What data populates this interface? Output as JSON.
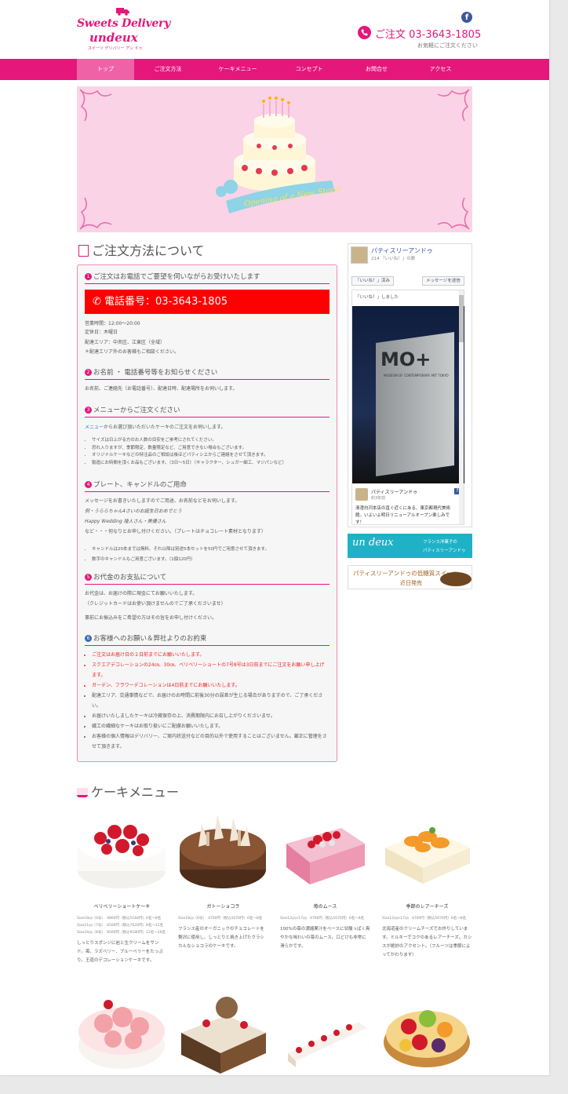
{
  "header": {
    "logo_line1": "Sweets Delivery",
    "logo_line2": "undeux",
    "logo_sub": "スイーツ デリバリー アン ドゥ",
    "order_tel": "ご注文 03-3643-1805",
    "order_note": "お気軽にご注文ください",
    "facebook_letter": "f"
  },
  "nav": [
    "トップ",
    "ご注文方法",
    "ケーキメニュー",
    "コンセプト",
    "お問合せ",
    "アクセス"
  ],
  "hero": {
    "banner_text": "Opening of a New Store!"
  },
  "order_section": {
    "title": "ご注文方法について",
    "step1": {
      "title": "ご注文はお電話でご要望を伺いながらお受けいたします",
      "tel": "電話番号：03-3643-1805",
      "lines": [
        "営業時間：12:00〜20:00",
        "定休日：木曜日",
        "配達エリア：中央区、江東区（全域）",
        "＊配達エリア外のお客様もご相談ください。"
      ]
    },
    "step2": {
      "title": "お名前 ・ 電話番号等をお知らせください",
      "text": "お名前、ご連絡先（お電話番号）、配達日時、配達場所をお伺いします。"
    },
    "step3": {
      "title": "メニューからご注文ください",
      "link": "メニュー",
      "text": "からお選び頂いただいたケーキのご注文をお伺いします。",
      "bullets": [
        "サイズは日上がる方のお人数の目安をご参考にされてください。",
        "恐れ入りますが、季節限定、数量限定など、ご用意できない場合もございます。",
        "オリジナルケーキなどの特注品のご相談は後ほどパティシエからご連絡をさせて頂きます。",
        "製造にお時間を頂くお品もございます。（3日〜5日）（キャラクター、シュガー細工、マジパンなど）"
      ]
    },
    "step4": {
      "title": "プレート、キャンドルのご用命",
      "lines": [
        "メッセージをお書きいたしますのでご用途、お名前などをお伺いします。",
        "例・うららちゃん4さいのお誕生日おめでとう",
        "Happy Wedding 隆人さん・美優さん",
        "など・・・何なりとお申し付けください。（プレートはチョコレート素材となります）"
      ],
      "bullets": [
        "キャンドルは20本までは無料、それ以降は別途5本セットを50円でご用意させて頂きます。",
        "数字のキャンドルもご用意ございます。（1個120円）"
      ]
    },
    "step5": {
      "title": "お代金のお支払について",
      "lines": [
        "お代金は、お届けの際に現金にてお願いいたします。",
        "（クレジットカードはお使い頂けませんのでご了承くださいませ）",
        "",
        "事前にお振込みをご希望の方はその旨をお申し付けください。"
      ]
    },
    "step6": {
      "title": "お客様へのお願い＆弊社よりのお約束",
      "bullets_red": [
        "ご注文はお届け日の２日前までにお願いいたします。",
        "スクエアデコレーションの24㎝、30㎝、ベリベリーショートの7号8号は3日前までにご注文をお願い申し上げます。",
        "ガーデン、フラワーデコレーションは4日前までにお願いいたします。"
      ],
      "bullets": [
        "配達エリア、交通事情などで、お届けのお時間に前後30分の誤差が生じる場合がありますので、ご了承ください。",
        "お届けいたしましたケーキは冷蔵保存の上、消費期限内にお召し上がりくださいませ。",
        "繊工の繊細なケーキはお取り扱いにご配慮お願いいたします。",
        "お客様の個人情報はデリバリー、ご案内状送付などの目的以外で使用することはございません。厳正に管理をさせて頂きます。"
      ]
    }
  },
  "fb_widget": {
    "page_name": "パティスリーアンドゥ",
    "likes": "214 「いいね！」の数",
    "like_btn": "「いいね！」済み",
    "msg_btn": "メッセージを送信",
    "liked_text": "「いいね！」しました",
    "photo_text": "MO+",
    "photo_small": "MUSEUM OF CONTEMPORARY ART TOKYO",
    "post_name": "パティスリーアンドゥ",
    "post_time": "約3年前",
    "post_text": "清澄白河本店の直ぐ近くにある、東京都現代美術館。いよいよ明日リニューアルオープン楽しみです！"
  },
  "ads": {
    "ad1_logo": "un deux",
    "ad1_line1": "フランス洋菓子の",
    "ad1_line2": "パティスリーアンドゥ",
    "ad2_text": "パティスリーアンドゥの低糖質スイーツ",
    "ad2_sub": "近日発売"
  },
  "cake_menu": {
    "title": "ケーキメニュー",
    "items": [
      {
        "name": "ベリベリーショートケーキ",
        "sizes": [
          "Size18㎝（6号）　4800円（税込5184円）6名〜8名",
          "Size21㎝（7号）　6500円（税込7020円）8名〜12名",
          "Size24㎝（8号）　8500円（税込9180円）12名〜16名"
        ],
        "desc": "しっとりスポンジに岩と生クリームをサンド。苺、ラズベリー、ブルーベリーをたっぷり。王道のデコレーションケーキです。"
      },
      {
        "name": "ガトーショコラ",
        "sizes": [
          "Size18㎝（6号）　4700円（税込5076円）6名〜8名"
        ],
        "desc": "フランス産のオーガニックのチョコレートを贅沢に使用し、しっとりと焼き上げたクラシカルなショコラのケーキです。"
      },
      {
        "name": "苺のムース",
        "sizes": [
          "Size12㎝×17㎝　4700円（税込5076円）6名〜8名"
        ],
        "desc": "100%の苺の濃縮果汁をベースに甘酸っぱく爽やかな味わいの苺のムース。口どけも非常に滑らかです。"
      },
      {
        "name": "季節のレアーチーズ",
        "sizes": [
          "Size12㎝×17㎝　4700円（税込5076円）6名〜8名"
        ],
        "desc": "北海道産のクリームチーズでお作りしています。ミルキーでコクのあるレアーチーズ。カシスが絶妙のアクセント。（フルーツは季節によってかわります）"
      }
    ]
  },
  "colors": {
    "accent": "#e5177b",
    "red_bar": "#ff0000",
    "hero_bg": "#fbd3e6",
    "ad_teal": "#1fb2c6",
    "facebook": "#3b5998"
  }
}
